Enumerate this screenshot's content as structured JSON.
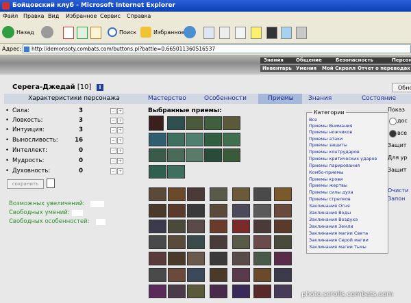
{
  "window": {
    "title": "Бойцовский клуб - Microsoft Internet Explorer"
  },
  "menu": [
    "Файл",
    "Правка",
    "Вид",
    "Избранное",
    "Сервис",
    "Справка"
  ],
  "toolbar": {
    "back": "Назад",
    "search": "Поиск",
    "favorites": "Избранное"
  },
  "address": {
    "label": "Адрес:",
    "url": "http://demonsoty.combats.com/buttons.pl?battle=0.665011360516537"
  },
  "game": {
    "system_menu": [
      "Знания",
      "Общение",
      "Безопасность",
      "Персон"
    ],
    "sub_menu": [
      "Инвентарь",
      "Умения",
      "Мой Скролл",
      "Отчет о переводах"
    ],
    "character": {
      "name": "Серега-Джедай",
      "level": "[10]"
    },
    "refresh_label": "Обно",
    "stats_header": "Характеристики персонажа",
    "stats": [
      {
        "name": "Сила:",
        "value": "3"
      },
      {
        "name": "Ловкость:",
        "value": "3"
      },
      {
        "name": "Интуиция:",
        "value": "3"
      },
      {
        "name": "Выносливость:",
        "value": "16"
      },
      {
        "name": "Интеллект:",
        "value": "0"
      },
      {
        "name": "Мудрость:",
        "value": "0"
      },
      {
        "name": "Духовность:",
        "value": "0"
      }
    ],
    "save_label": "сохранить",
    "free_stats": [
      "Возможных увеличений:",
      "Свободных умений:",
      "Свободных особенностей:"
    ],
    "tabs": [
      "Мастерство",
      "Особенности",
      "Приемы",
      "Знания",
      "Состояние"
    ],
    "selected_skills_label": "Выбранные приемы:",
    "categories_title": "Категории",
    "categories": [
      "Все",
      "Приемы Внимания",
      "Приемы ножчиков",
      "Приемы атаки",
      "Приемы защиты",
      "Приемы контрударов",
      "Приемы критических ударов",
      "Приемы парирования",
      "Комбо-приемы",
      "Приемы крови",
      "Приемы жертвы",
      "Приемы силы духа",
      "Приемы стрелков",
      "Заклинания Огня",
      "Заклинания Воды",
      "Заклинания Воздуха",
      "Заклинания Земли",
      "Заклинания магии Света",
      "Заклинания Серой магии",
      "Заклинания магии Тьмы"
    ],
    "right_options": {
      "show": "Показ",
      "opt1": "дос",
      "opt2": "все",
      "protect": "Защит",
      "for": "Для ур",
      "protect2": "Защит",
      "clear": "Очисти",
      "fill": "Запон"
    }
  },
  "watermark": "photo.scrolls.combats.com",
  "colors": {
    "titlebar": "#0a3fb8",
    "tab_text": "#1a2f8f",
    "green_text": "#2f8f2f",
    "category_link": "#1a2f9a"
  }
}
